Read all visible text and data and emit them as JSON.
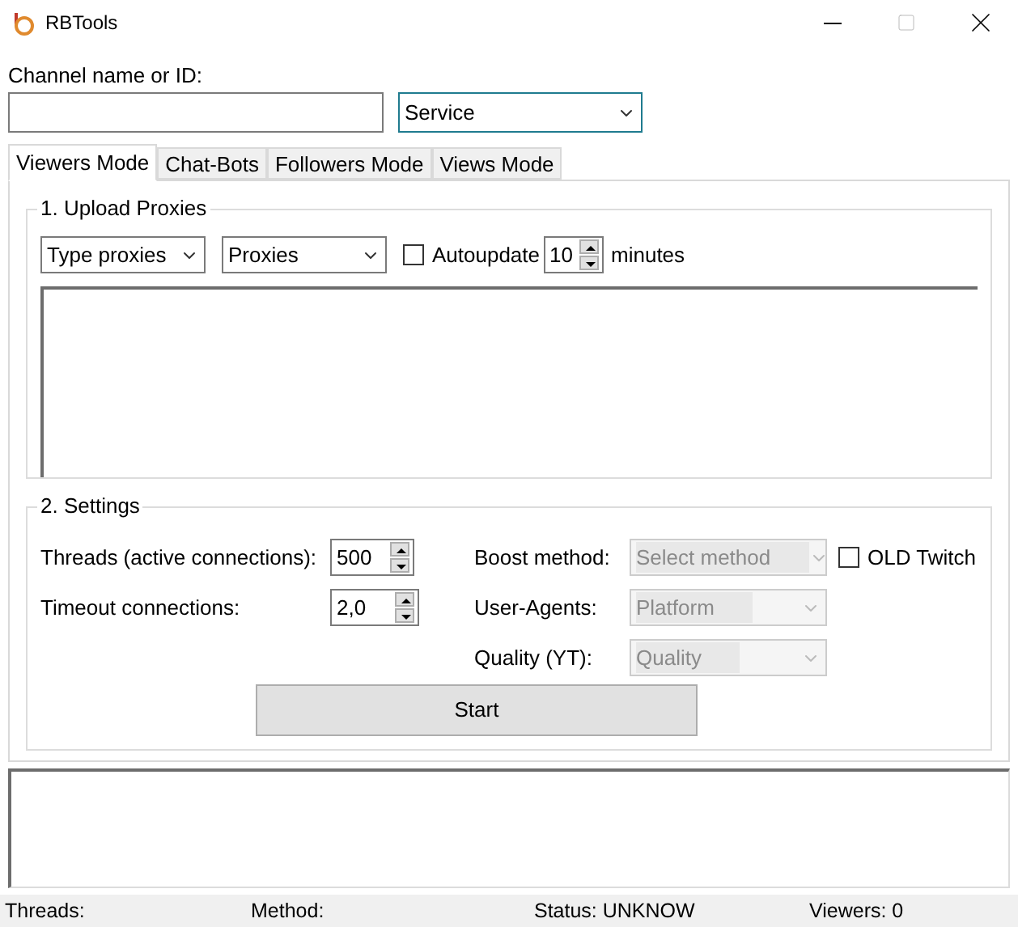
{
  "window": {
    "title": "RBTools"
  },
  "channel": {
    "label": "Channel name or ID:",
    "service": "Service"
  },
  "tabs": [
    {
      "label": "Viewers Mode",
      "selected": true
    },
    {
      "label": "Chat-Bots",
      "selected": false
    },
    {
      "label": "Followers Mode",
      "selected": false
    },
    {
      "label": "Views Mode",
      "selected": false
    }
  ],
  "upload_proxies": {
    "title": "1. Upload Proxies",
    "type_select": "Type proxies",
    "proxies_select": "Proxies",
    "autoupdate": {
      "label": "Autoupdate",
      "checked": false
    },
    "interval": "10",
    "unit": "minutes"
  },
  "settings": {
    "title": "2. Settings",
    "spinners": [
      {
        "label": "Threads (active connections):",
        "value": "500"
      },
      {
        "label": "Timeout connections:",
        "value": "2,0"
      }
    ],
    "selects": [
      {
        "label": "Boost method:",
        "value": "Select method",
        "disabled": true
      },
      {
        "label": "User-Agents:",
        "value": "Platform",
        "disabled": true
      },
      {
        "label": "Quality (YT):",
        "value": "Quality",
        "disabled": true
      }
    ],
    "old_twitch": {
      "label": "OLD Twitch",
      "checked": false
    },
    "start_button": "Start"
  },
  "status_bar": [
    "Threads:",
    "Method:",
    "Status: UNKNOW",
    "Viewers: 0"
  ]
}
